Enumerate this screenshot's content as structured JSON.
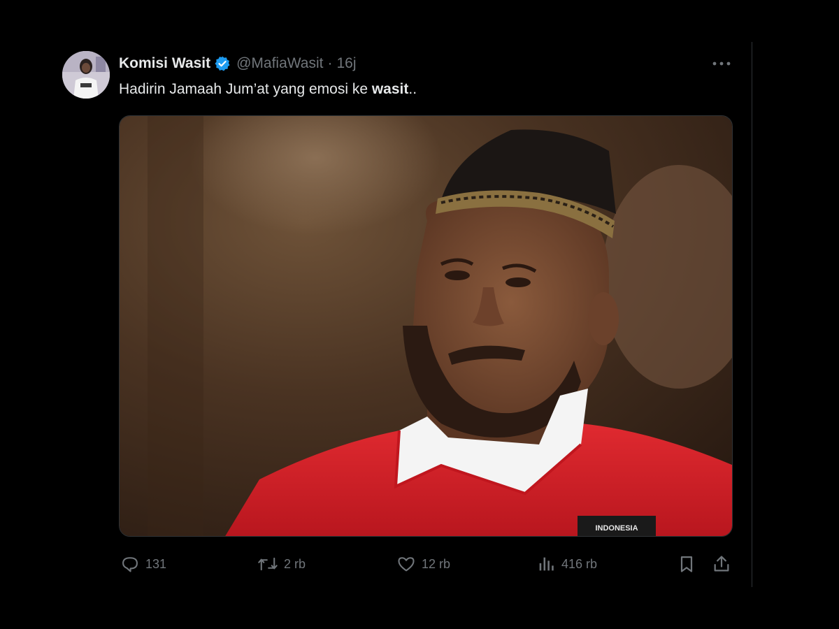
{
  "tweet": {
    "display_name": "Komisi Wasit",
    "handle": "@MafiaWasit",
    "separator": "·",
    "time": "16j",
    "text_plain": "Hadirin Jamaah Jum’at yang emosi ke ",
    "text_bold": "wasit",
    "text_tail": "..",
    "jersey_text": "INDONESIA"
  },
  "icons": {
    "verified": "verified-badge-icon",
    "more": "more-dots-icon",
    "reply": "reply-icon",
    "retweet": "retweet-icon",
    "like": "heart-icon",
    "views": "views-chart-icon",
    "bookmark": "bookmark-icon",
    "share": "share-icon"
  },
  "stats": {
    "replies": "131",
    "retweets": "2 rb",
    "likes": "12 rb",
    "views": "416 rb"
  },
  "colors": {
    "background": "#000000",
    "text_primary": "#e7e9ea",
    "text_secondary": "#71767b",
    "verified_blue": "#1d9bf0",
    "jersey_red": "#d3202a"
  }
}
